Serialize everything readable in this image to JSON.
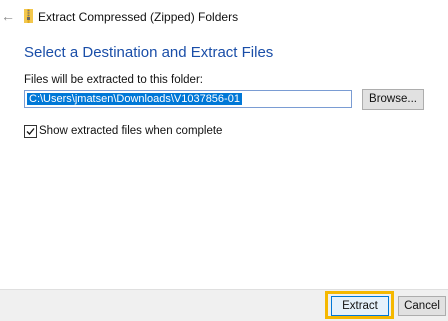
{
  "window": {
    "title": "Extract Compressed (Zipped) Folders",
    "back_icon": "back-arrow-icon",
    "app_icon": "zip-folder-icon"
  },
  "main": {
    "heading": "Select a Destination and Extract Files",
    "folder_label": "Files will be extracted to this folder:",
    "path_value": "C:\\Users\\jmatsen\\Downloads\\V1037856-01",
    "browse_label": "Browse...",
    "show_files_label": "Show extracted files when complete",
    "show_files_checked": true
  },
  "footer": {
    "extract_label": "Extract",
    "cancel_label": "Cancel"
  },
  "colors": {
    "heading": "#1a4ea8",
    "selection": "#0078d7",
    "highlight": "#f5b800"
  }
}
